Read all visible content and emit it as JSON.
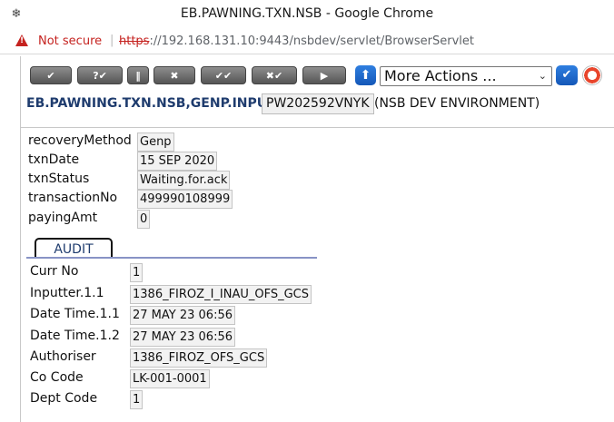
{
  "window": {
    "title": "EB.PAWNING.TXN.NSB - Google Chrome"
  },
  "address_bar": {
    "security_label": "Not secure",
    "separator": "|",
    "url_scheme": "https",
    "url_rest": "://192.168.131.10:9443/nsbdev/servlet/BrowserServlet"
  },
  "toolbar": {
    "buttons": [
      {
        "icon": "check-icon",
        "glyph": "✔"
      },
      {
        "icon": "validate-icon",
        "glyph": "?✔"
      },
      {
        "icon": "hold-icon",
        "glyph": "‖"
      },
      {
        "icon": "delete-icon",
        "glyph": "✖"
      },
      {
        "icon": "authorise-icon",
        "glyph": "✔✔"
      },
      {
        "icon": "reverse-icon",
        "glyph": "✖✔"
      },
      {
        "icon": "next-icon",
        "glyph": "▶"
      }
    ],
    "more_actions": "More Actions ...",
    "colors": {
      "button": "#6f6f6f",
      "accent": "#1f6fd6",
      "title": "#1f3c6e"
    }
  },
  "header": {
    "application": "EB.PAWNING.TXN.NSB,GENP.INPUT",
    "transaction_id": "PW202592VNYK",
    "environment": "(NSB DEV ENVIRONMENT)"
  },
  "fields": [
    {
      "label": "recoveryMethod",
      "value": "Genp"
    },
    {
      "label": "txnDate",
      "value": "15 SEP 2020"
    },
    {
      "label": "txnStatus",
      "value": "Waiting.for.ack"
    },
    {
      "label": "transactionNo",
      "value": "499990108999"
    },
    {
      "label": "payingAmt",
      "value": "0"
    }
  ],
  "audit": {
    "tab_label": "AUDIT",
    "fields": [
      {
        "label": "Curr No",
        "value": "1"
      },
      {
        "label": "Inputter.1.1",
        "value": "1386_FIROZ_I_INAU_OFS_GCS"
      },
      {
        "label": "Date Time.1.1",
        "value": "27 MAY 23 06:56"
      },
      {
        "label": "Date Time.1.2",
        "value": "27 MAY 23 06:56"
      },
      {
        "label": "Authoriser",
        "value": "1386_FIROZ_OFS_GCS"
      },
      {
        "label": "Co Code",
        "value": "LK-001-0001"
      },
      {
        "label": "Dept Code",
        "value": "1"
      }
    ]
  }
}
